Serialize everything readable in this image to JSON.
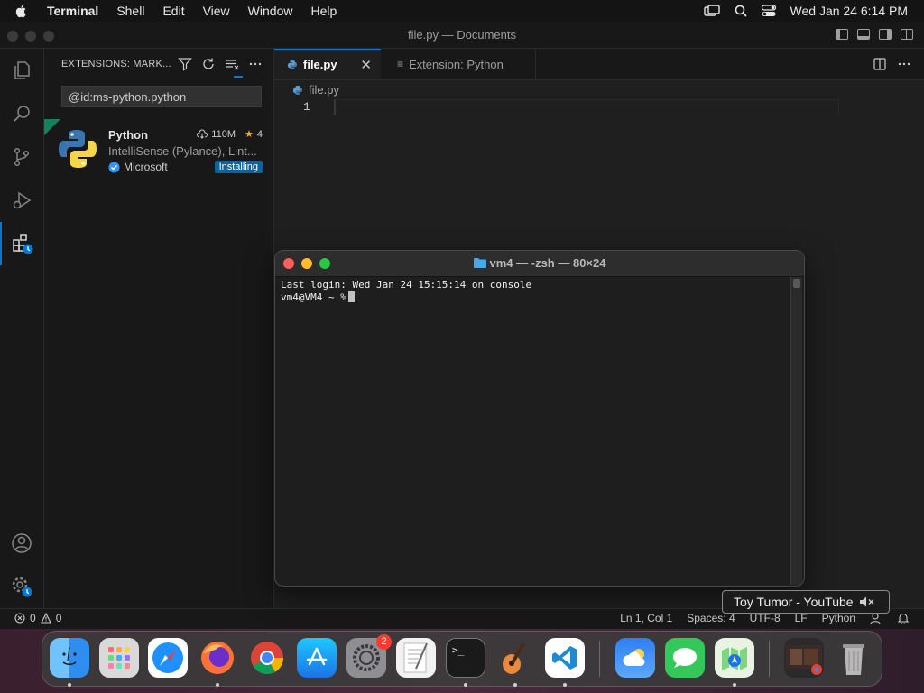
{
  "menubar": {
    "app_name": "Terminal",
    "menus": [
      "Shell",
      "Edit",
      "View",
      "Window",
      "Help"
    ],
    "datetime": "Wed Jan 24  6:14 PM"
  },
  "vscode": {
    "window_title": "file.py — Documents",
    "sidebar": {
      "header": "EXTENSIONS: MARK...",
      "search_value": "@id:ms-python.python",
      "extension": {
        "name": "Python",
        "downloads": "110M",
        "rating": "4",
        "description": "IntelliSense (Pylance), Lint...",
        "publisher": "Microsoft",
        "status": "Installing"
      }
    },
    "tabs": [
      {
        "label": "file.py",
        "active": true
      },
      {
        "label": "Extension: Python",
        "active": false
      }
    ],
    "breadcrumb": "file.py",
    "line_number": "1",
    "statusbar": {
      "errors": "0",
      "warnings": "0",
      "position": "Ln 1, Col 1",
      "spaces": "Spaces: 4",
      "encoding": "UTF-8",
      "eol": "LF",
      "language": "Python"
    }
  },
  "terminal": {
    "title": "vm4 — -zsh — 80×24",
    "line1": "Last login: Wed Jan 24 15:15:14 on console",
    "prompt": "vm4@VM4 ~ %"
  },
  "tooltip": {
    "text": "Toy Tumor - YouTube"
  },
  "dock": {
    "apps": [
      "finder",
      "launchpad",
      "safari",
      "firefox",
      "chrome",
      "app-store",
      "system-settings",
      "textedit",
      "terminal",
      "garageband",
      "vscode",
      "weather",
      "messages",
      "maps",
      "youtube-window",
      "trash"
    ],
    "settings_badge": "2"
  },
  "colors": {
    "accent": "#0078d4",
    "installing_badge": "#0e639c",
    "close": "#ff5f57",
    "minimize": "#febc2e",
    "zoom": "#28c840"
  }
}
